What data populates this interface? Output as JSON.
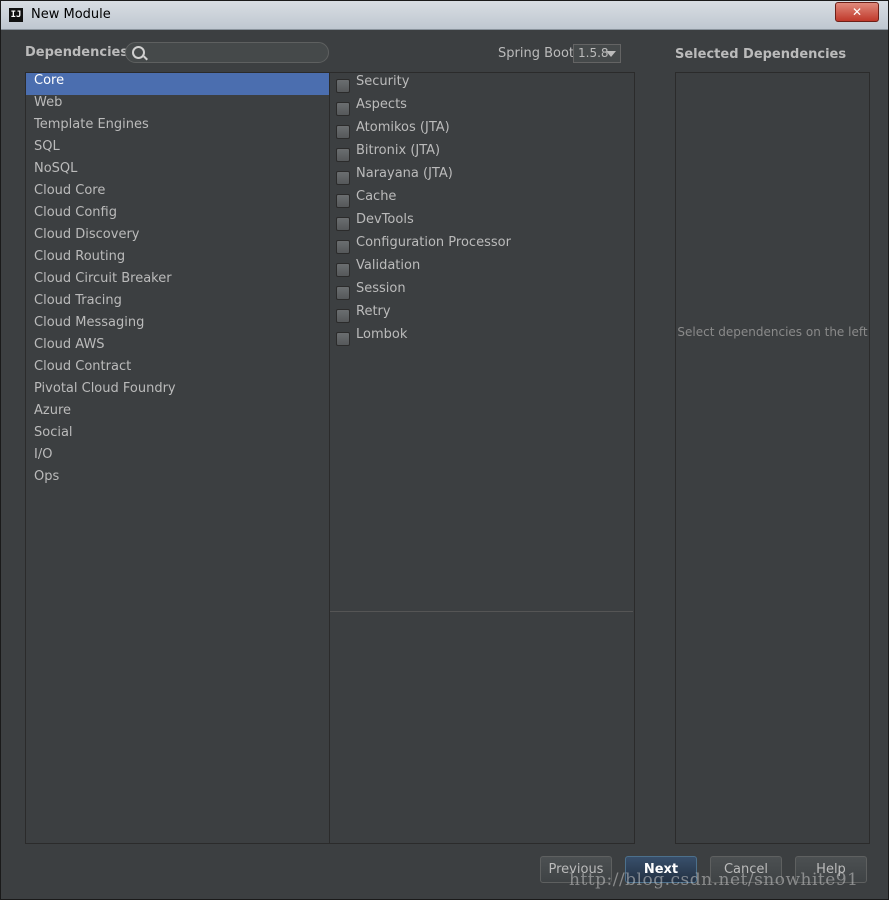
{
  "window": {
    "title": "New Module",
    "app_icon": "IJ",
    "close_icon": "✕"
  },
  "dependencies_label": "Dependencies",
  "search": {
    "value": "",
    "placeholder": ""
  },
  "spring_boot": {
    "label": "Spring Boot",
    "selected": "1.5.8"
  },
  "categories": [
    {
      "label": "Core",
      "selected": true
    },
    {
      "label": "Web"
    },
    {
      "label": "Template Engines"
    },
    {
      "label": "SQL"
    },
    {
      "label": "NoSQL"
    },
    {
      "label": "Cloud Core"
    },
    {
      "label": "Cloud Config"
    },
    {
      "label": "Cloud Discovery"
    },
    {
      "label": "Cloud Routing"
    },
    {
      "label": "Cloud Circuit Breaker"
    },
    {
      "label": "Cloud Tracing"
    },
    {
      "label": "Cloud Messaging"
    },
    {
      "label": "Cloud AWS"
    },
    {
      "label": "Cloud Contract"
    },
    {
      "label": "Pivotal Cloud Foundry"
    },
    {
      "label": "Azure"
    },
    {
      "label": "Social"
    },
    {
      "label": "I/O"
    },
    {
      "label": "Ops"
    }
  ],
  "dependency_items": [
    {
      "label": "Security",
      "checked": false
    },
    {
      "label": "Aspects",
      "checked": false
    },
    {
      "label": "Atomikos (JTA)",
      "checked": false
    },
    {
      "label": "Bitronix (JTA)",
      "checked": false
    },
    {
      "label": "Narayana (JTA)",
      "checked": false
    },
    {
      "label": "Cache",
      "checked": false
    },
    {
      "label": "DevTools",
      "checked": false
    },
    {
      "label": "Configuration Processor",
      "checked": false
    },
    {
      "label": "Validation",
      "checked": false
    },
    {
      "label": "Session",
      "checked": false
    },
    {
      "label": "Retry",
      "checked": false
    },
    {
      "label": "Lombok",
      "checked": false
    }
  ],
  "selected_dependencies": {
    "title": "Selected Dependencies",
    "empty_text": "Select dependencies on the left"
  },
  "buttons": {
    "previous": "Previous",
    "next": "Next",
    "cancel": "Cancel",
    "help": "Help"
  },
  "watermark": "http://blog.csdn.net/snowhite91",
  "colors": {
    "background": "#3c3f41",
    "selection": "#4b6eaf",
    "primary_button": "#2d3e52",
    "text": "#bbbbbb"
  }
}
